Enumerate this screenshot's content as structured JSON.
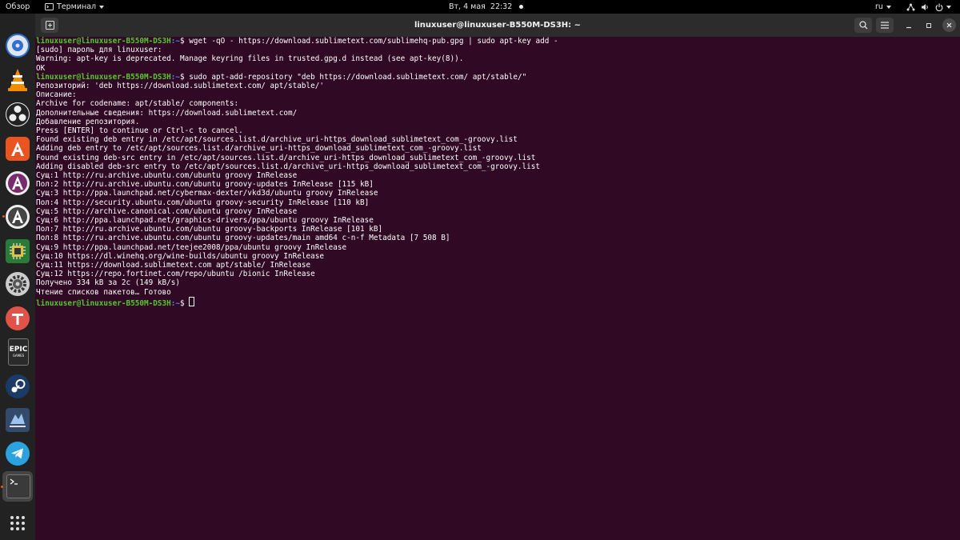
{
  "topbar": {
    "activities": "Обзор",
    "app_menu": "Терминал",
    "clock": "Вт, 4 мая  22:32",
    "keyboard_layout": "ru"
  },
  "colors": {
    "terminal_bg": "#300a24",
    "prompt_user": "#57c72f",
    "prompt_path": "#5c7cf0",
    "dock_bg": "#222222",
    "titlebar_bg": "#2c2c2c",
    "accent": "#e95420"
  },
  "dock": {
    "apps": [
      {
        "name": "disks-icon"
      },
      {
        "name": "vlc-icon"
      },
      {
        "name": "obs-studio-icon"
      },
      {
        "name": "software-center-icon"
      },
      {
        "name": "app-icon-a-1"
      },
      {
        "name": "app-icon-a-2"
      },
      {
        "name": "chip-app-icon"
      },
      {
        "name": "settings-gear-icon"
      },
      {
        "name": "tor-flame-icon"
      },
      {
        "name": "epic-games-icon"
      },
      {
        "name": "steam-icon"
      },
      {
        "name": "battle-app-icon"
      },
      {
        "name": "telegram-icon"
      },
      {
        "name": "terminal-icon"
      },
      {
        "name": "show-apps-grid-icon"
      }
    ],
    "epic_label": "EPIC",
    "epic_sub": "GAMES"
  },
  "window": {
    "title": "linuxuser@linuxuser-B550M-DS3H: ~",
    "prompt_user": "linuxuser@linuxuser-B550M-DS3H",
    "prompt_path": ":~",
    "prompt_symbol": "$",
    "lines": [
      {
        "prompt": true,
        "text": " wget -qO - https://download.sublimetext.com/sublimehq-pub.gpg | sudo apt-key add -"
      },
      {
        "text": "[sudo] пароль для linuxuser:"
      },
      {
        "text": "Warning: apt-key is deprecated. Manage keyring files in trusted.gpg.d instead (see apt-key(8))."
      },
      {
        "text": "OK"
      },
      {
        "prompt": true,
        "text": " sudo apt-add-repository \"deb https://download.sublimetext.com/ apt/stable/\""
      },
      {
        "text": "Репозиторий: 'deb https://download.sublimetext.com/ apt/stable/'"
      },
      {
        "text": "Описание:"
      },
      {
        "text": "Archive for codename: apt/stable/ components:"
      },
      {
        "text": "Дополнительные сведения: https://download.sublimetext.com/"
      },
      {
        "text": "Добавление репозитория."
      },
      {
        "text": "Press [ENTER] to continue or Ctrl-c to cancel."
      },
      {
        "text": "Found existing deb entry in /etc/apt/sources.list.d/archive_uri-https_download_sublimetext_com_-groovy.list"
      },
      {
        "text": "Adding deb entry to /etc/apt/sources.list.d/archive_uri-https_download_sublimetext_com_-groovy.list"
      },
      {
        "text": "Found existing deb-src entry in /etc/apt/sources.list.d/archive_uri-https_download_sublimetext_com_-groovy.list"
      },
      {
        "text": "Adding disabled deb-src entry to /etc/apt/sources.list.d/archive_uri-https_download_sublimetext_com_-groovy.list"
      },
      {
        "text": "Сущ:1 http://ru.archive.ubuntu.com/ubuntu groovy InRelease"
      },
      {
        "text": "Пол:2 http://ru.archive.ubuntu.com/ubuntu groovy-updates InRelease [115 kB]"
      },
      {
        "text": "Сущ:3 http://ppa.launchpad.net/cybermax-dexter/vkd3d/ubuntu groovy InRelease"
      },
      {
        "text": "Пол:4 http://security.ubuntu.com/ubuntu groovy-security InRelease [110 kB]"
      },
      {
        "text": "Сущ:5 http://archive.canonical.com/ubuntu groovy InRelease"
      },
      {
        "text": "Сущ:6 http://ppa.launchpad.net/graphics-drivers/ppa/ubuntu groovy InRelease"
      },
      {
        "text": "Пол:7 http://ru.archive.ubuntu.com/ubuntu groovy-backports InRelease [101 kB]"
      },
      {
        "text": "Пол:8 http://ru.archive.ubuntu.com/ubuntu groovy-updates/main amd64 c-n-f Metadata [7 508 B]"
      },
      {
        "text": "Сущ:9 http://ppa.launchpad.net/teejee2008/ppa/ubuntu groovy InRelease"
      },
      {
        "text": "Сущ:10 https://dl.winehq.org/wine-builds/ubuntu groovy InRelease"
      },
      {
        "text": "Сущ:11 https://download.sublimetext.com apt/stable/ InRelease"
      },
      {
        "text": "Сущ:12 https://repo.fortinet.com/repo/ubuntu /bionic InRelease"
      },
      {
        "text": "Получено 334 kB за 2с (149 kB/s)"
      },
      {
        "text": "Чтение списков пакетов… Готово"
      },
      {
        "prompt": true,
        "text": " ",
        "cursor": true
      }
    ]
  }
}
